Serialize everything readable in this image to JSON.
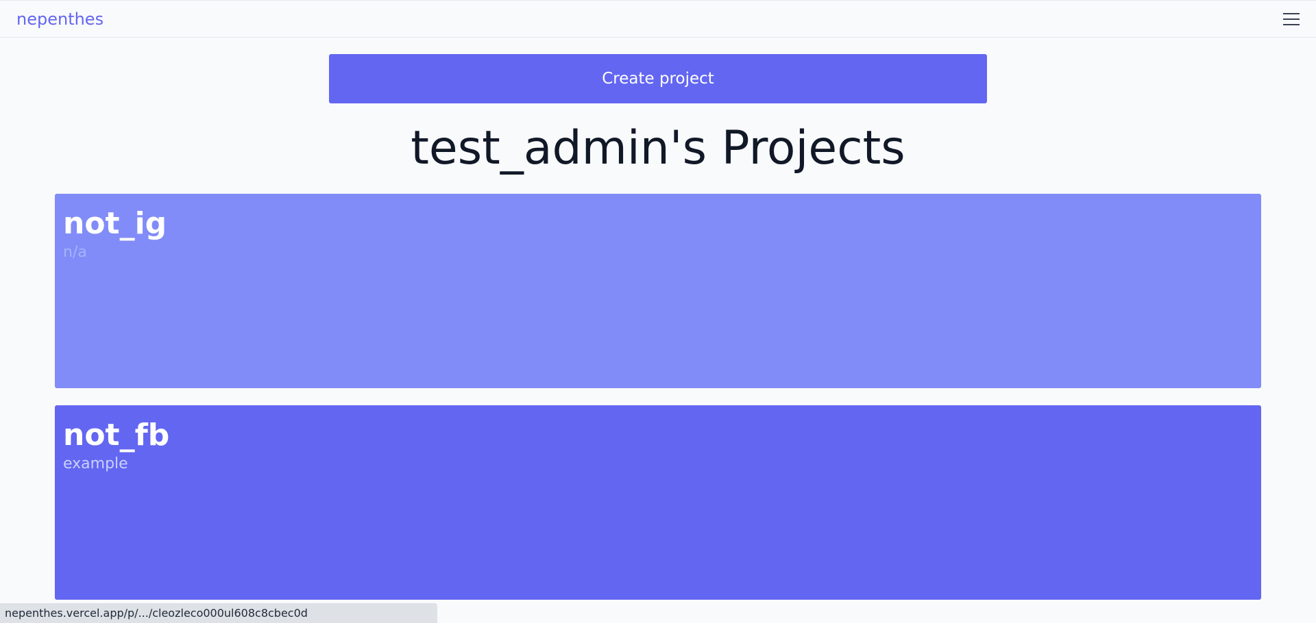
{
  "navbar": {
    "brand": "nepenthes",
    "menu_icon": "hamburger-menu-icon"
  },
  "actions": {
    "create_project_label": "Create project"
  },
  "page": {
    "title": "test_admin's Projects"
  },
  "projects": [
    {
      "name": "not_ig",
      "description": "n/a",
      "color": "#818cf8"
    },
    {
      "name": "not_fb",
      "description": "example",
      "color": "#6366f1"
    }
  ],
  "status_bar": {
    "url": "nepenthes.vercel.app/p/.../cleozleco000ul608c8cbec0d"
  },
  "colors": {
    "accent": "#6366f1",
    "accent_light": "#818cf8",
    "background": "#f9fafb",
    "title_text": "#111827"
  }
}
